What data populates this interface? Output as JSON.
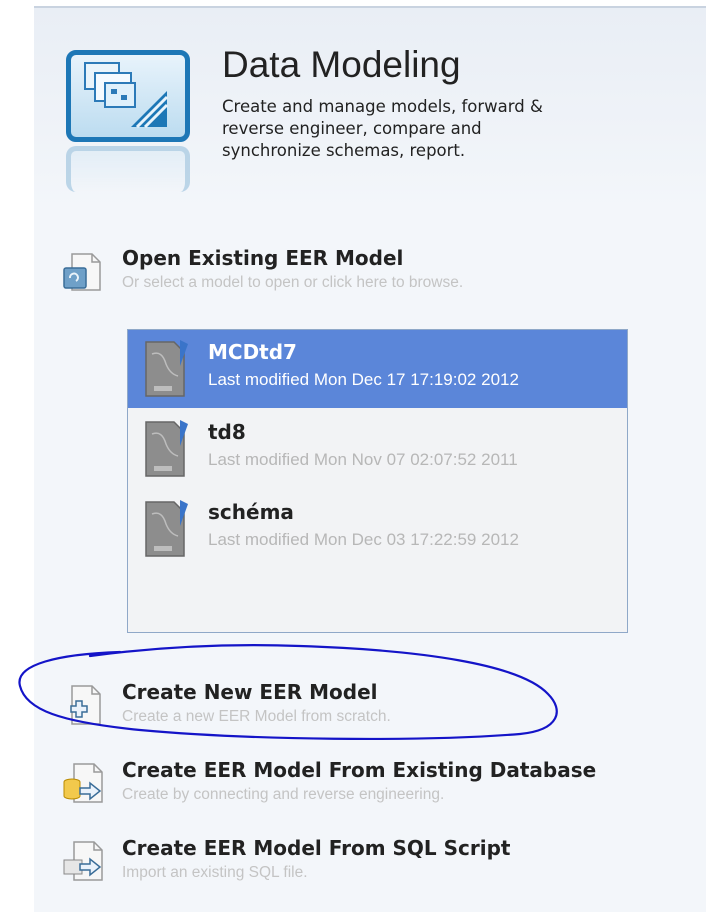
{
  "header": {
    "title": "Data Modeling",
    "description_lines": [
      "Create and manage models, forward &",
      "reverse engineer, compare and",
      "synchronize schemas, report."
    ],
    "icon": "data-modeling-icon"
  },
  "open_model": {
    "title": "Open Existing EER Model",
    "subtitle": "Or select a model to open or click here to browse."
  },
  "models": [
    {
      "name": "MCDtd7",
      "modified": "Last modified Mon Dec 17 17:19:02 2012",
      "selected": true
    },
    {
      "name": "td8",
      "modified": "Last modified Mon Nov 07 02:07:52 2011",
      "selected": false
    },
    {
      "name": "schéma",
      "modified": "Last modified Mon Dec 03 17:22:59 2012",
      "selected": false
    }
  ],
  "actions": {
    "create_new": {
      "title": "Create New EER Model",
      "subtitle": "Create a new EER Model from scratch."
    },
    "from_database": {
      "title": "Create EER Model From Existing Database",
      "subtitle": "Create by connecting and reverse engineering."
    },
    "from_script": {
      "title": "Create EER Model From SQL Script",
      "subtitle": "Import an existing SQL file."
    }
  },
  "colors": {
    "selection": "#5b86d9",
    "accent": "#1d77b6",
    "annotation": "#1414c8"
  }
}
